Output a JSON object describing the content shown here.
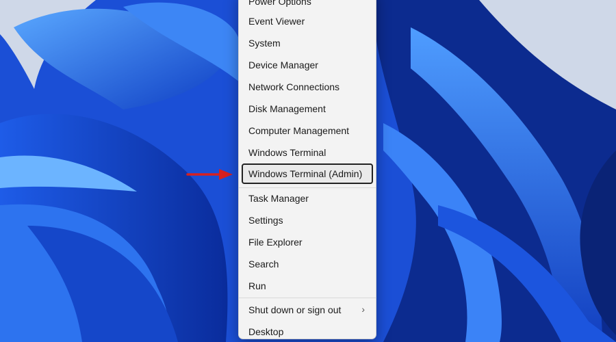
{
  "colors": {
    "menu_background": "#f3f3f3",
    "selection_border": "#222222",
    "arrow": "#d72020",
    "wallpaper_blue": "#1b4fd6"
  },
  "menu": {
    "items": [
      {
        "label": "Power Options"
      },
      {
        "label": "Event Viewer"
      },
      {
        "label": "System"
      },
      {
        "label": "Device Manager"
      },
      {
        "label": "Network Connections"
      },
      {
        "label": "Disk Management"
      },
      {
        "label": "Computer Management"
      },
      {
        "label": "Windows Terminal"
      },
      {
        "label": "Windows Terminal (Admin)",
        "selected": true
      },
      {
        "label": "Task Manager"
      },
      {
        "label": "Settings"
      },
      {
        "label": "File Explorer"
      },
      {
        "label": "Search"
      },
      {
        "label": "Run"
      },
      {
        "label": "Shut down or sign out",
        "submenu": true
      },
      {
        "label": "Desktop"
      }
    ],
    "submenu_icon": "chevron-right-icon"
  },
  "annotation": {
    "icon": "red-arrow-icon"
  }
}
